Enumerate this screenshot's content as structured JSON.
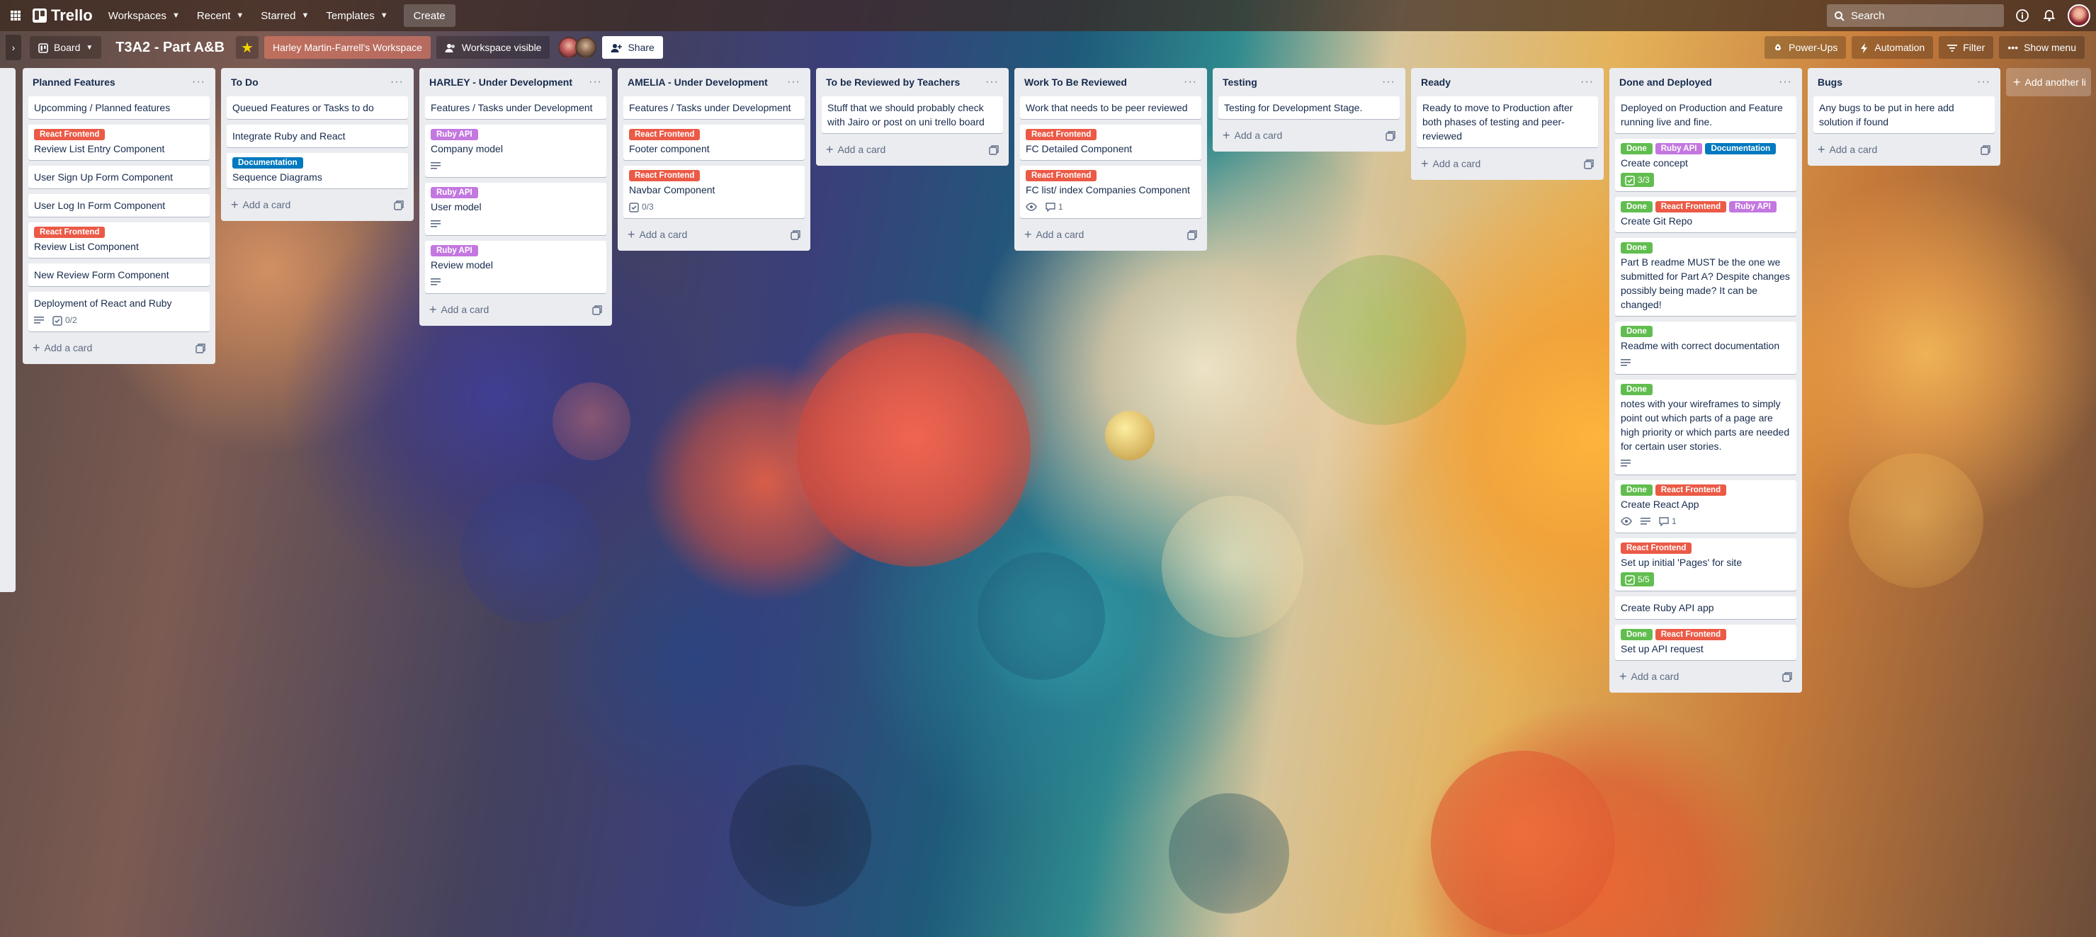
{
  "topnav": {
    "logo": "Trello",
    "menus": [
      "Workspaces",
      "Recent",
      "Starred",
      "Templates"
    ],
    "create": "Create",
    "search_placeholder": "Search"
  },
  "board": {
    "view": "Board",
    "title": "T3A2 - Part A&B",
    "workspace": "Harley Martin-Farrell's Workspace",
    "visibility": "Workspace visible",
    "share": "Share",
    "powerups": "Power-Ups",
    "automation": "Automation",
    "filter": "Filter",
    "show_menu": "Show menu",
    "add_another_list": "Add another li"
  },
  "label_colors": {
    "React Frontend": "#eb5a46",
    "Ruby API": "#c377e0",
    "Documentation": "#0079bf",
    "Done": "#61bd4f"
  },
  "add_card": "Add a card",
  "lists": [
    {
      "title": "Planned Features",
      "cards": [
        {
          "title": "Upcomming / Planned features",
          "labels": []
        },
        {
          "title": "Review List Entry Component",
          "labels": [
            "React Frontend"
          ]
        },
        {
          "title": "User Sign Up Form Component",
          "labels": []
        },
        {
          "title": "User Log In Form Component",
          "labels": []
        },
        {
          "title": "Review List Component",
          "labels": [
            "React Frontend"
          ]
        },
        {
          "title": "New Review Form Component",
          "labels": []
        },
        {
          "title": "Deployment of React and Ruby",
          "labels": [],
          "badges": {
            "desc": true,
            "checklist": "0/2"
          }
        }
      ]
    },
    {
      "title": "To Do",
      "cards": [
        {
          "title": "Queued Features or Tasks to do",
          "labels": []
        },
        {
          "title": "Integrate Ruby and React",
          "labels": []
        },
        {
          "title": "Sequence Diagrams",
          "labels": [
            "Documentation"
          ]
        }
      ]
    },
    {
      "title": "HARLEY - Under Development",
      "cards": [
        {
          "title": "Features / Tasks under Development",
          "labels": []
        },
        {
          "title": "Company model",
          "labels": [
            "Ruby API"
          ],
          "badges": {
            "desc": true
          }
        },
        {
          "title": "User model",
          "labels": [
            "Ruby API"
          ],
          "badges": {
            "desc": true
          }
        },
        {
          "title": "Review model",
          "labels": [
            "Ruby API"
          ],
          "badges": {
            "desc": true
          }
        }
      ]
    },
    {
      "title": "AMELIA - Under Development",
      "cards": [
        {
          "title": "Features / Tasks under Development",
          "labels": []
        },
        {
          "title": "Footer component",
          "labels": [
            "React Frontend"
          ]
        },
        {
          "title": "Navbar Component",
          "labels": [
            "React Frontend"
          ],
          "badges": {
            "checklist": "0/3"
          }
        }
      ]
    },
    {
      "title": "To be Reviewed by Teachers",
      "cards": [
        {
          "title": "Stuff that we should probably check with Jairo or post on uni trello board",
          "labels": []
        }
      ]
    },
    {
      "title": "Work To Be Reviewed",
      "cards": [
        {
          "title": "Work that needs to be peer reviewed",
          "labels": []
        },
        {
          "title": "FC Detailed Component",
          "labels": [
            "React Frontend"
          ]
        },
        {
          "title": "FC list/ index Companies Component",
          "labels": [
            "React Frontend"
          ],
          "badges": {
            "watch": true,
            "comments": "1"
          }
        }
      ]
    },
    {
      "title": "Testing",
      "cards": [
        {
          "title": "Testing for Development Stage.",
          "labels": []
        }
      ]
    },
    {
      "title": "Ready",
      "cards": [
        {
          "title": "Ready to move to Production after both phases of testing and peer-reviewed",
          "labels": []
        }
      ]
    },
    {
      "title": "Done and Deployed",
      "cards": [
        {
          "title": "Deployed on Production and Feature running live and fine.",
          "labels": []
        },
        {
          "title": "Create concept",
          "labels": [
            "Done",
            "Ruby API",
            "Documentation"
          ],
          "badges": {
            "checklist_done": "3/3"
          }
        },
        {
          "title": "Create Git Repo",
          "labels": [
            "Done",
            "React Frontend",
            "Ruby API"
          ]
        },
        {
          "title": "Part B readme MUST be the one we submitted for Part A? Despite changes possibly being made? It can be changed!",
          "labels": [
            "Done"
          ]
        },
        {
          "title": "Readme with correct documentation",
          "labels": [
            "Done"
          ],
          "badges": {
            "desc": true
          }
        },
        {
          "title": "notes with your wireframes to simply point out which parts of a page are high priority or which parts are needed for certain user stories.",
          "labels": [
            "Done"
          ],
          "badges": {
            "desc": true
          }
        },
        {
          "title": "Create React App",
          "labels": [
            "Done",
            "React Frontend"
          ],
          "badges": {
            "watch": true,
            "desc": true,
            "comments": "1"
          }
        },
        {
          "title": "Set up initial 'Pages' for site",
          "labels": [
            "React Frontend"
          ],
          "badges": {
            "checklist_done": "5/5"
          }
        },
        {
          "title": "Create Ruby API app",
          "labels": []
        },
        {
          "title": "Set up API request",
          "labels": [
            "Done",
            "React Frontend"
          ]
        }
      ]
    },
    {
      "title": "Bugs",
      "cards": [
        {
          "title": "Any bugs to be put in here add solution if found",
          "labels": []
        }
      ]
    }
  ]
}
